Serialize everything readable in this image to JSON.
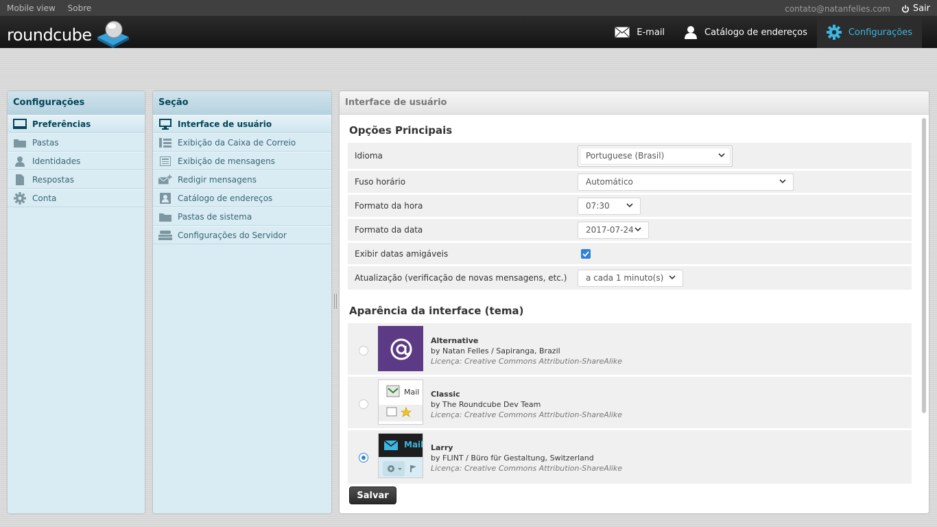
{
  "topline": {
    "links": [
      "Mobile view",
      "Sobre"
    ],
    "user": "contato@natanfelles.com",
    "logout": "Sair"
  },
  "header": {
    "logo_text": "roundcube",
    "tasks": [
      {
        "label": "E-mail",
        "icon": "envelope-icon"
      },
      {
        "label": "Catálogo de endereços",
        "icon": "person-icon"
      },
      {
        "label": "Configurações",
        "icon": "gear-icon",
        "selected": true
      }
    ]
  },
  "settings_panel": {
    "title": "Configurações",
    "items": [
      {
        "label": "Preferências",
        "icon": "monitor-icon",
        "selected": true
      },
      {
        "label": "Pastas",
        "icon": "folder-icon"
      },
      {
        "label": "Identidades",
        "icon": "person-icon"
      },
      {
        "label": "Respostas",
        "icon": "document-icon"
      },
      {
        "label": "Conta",
        "icon": "gear-icon"
      }
    ]
  },
  "section_panel": {
    "title": "Seção",
    "items": [
      {
        "label": "Interface de usuário",
        "icon": "monitor-icon",
        "selected": true
      },
      {
        "label": "Exibição da Caixa de Correio",
        "icon": "list-icon"
      },
      {
        "label": "Exibição de mensagens",
        "icon": "message-icon"
      },
      {
        "label": "Redigir mensagens",
        "icon": "compose-icon"
      },
      {
        "label": "Catálogo de endereços",
        "icon": "contact-card-icon"
      },
      {
        "label": "Pastas de sistema",
        "icon": "folder-icon"
      },
      {
        "label": "Configurações do Servidor",
        "icon": "server-icon"
      }
    ]
  },
  "main": {
    "title": "Interface de usuário",
    "main_options": {
      "legend": "Opções Principais",
      "rows": [
        {
          "label": "Idioma",
          "value": "Portuguese (Brasil)"
        },
        {
          "label": "Fuso horário",
          "value": "Automático"
        },
        {
          "label": "Formato da hora",
          "value": "07:30"
        },
        {
          "label": "Formato da data",
          "value": "2017-07-24"
        },
        {
          "label": "Exibir datas amigáveis",
          "checked": true
        },
        {
          "label": "Atualização (verificação de novas mensagens, etc.)",
          "value": "a cada 1 minuto(s)"
        }
      ]
    },
    "skins": {
      "legend": "Aparência da interface (tema)",
      "items": [
        {
          "name": "Alternative",
          "by": "by Natan Felles / Sapiranga, Brazil",
          "license": "Licença: Creative Commons Attribution-ShareAlike",
          "selected": false
        },
        {
          "name": "Classic",
          "by": "by The Roundcube Dev Team",
          "license": "Licença: Creative Commons Attribution-ShareAlike",
          "selected": false,
          "thumb_label": "Mail"
        },
        {
          "name": "Larry",
          "by": "by FLINT / Büro für Gestaltung, Switzerland",
          "license": "Licença: Creative Commons Attribution-ShareAlike",
          "selected": true,
          "thumb_label": "Mail"
        }
      ]
    },
    "save_label": "Salvar"
  },
  "colors": {
    "accent": "#3cb6e3",
    "panel_bg": "#d9ecf4",
    "checkbox": "#2e83d8"
  }
}
